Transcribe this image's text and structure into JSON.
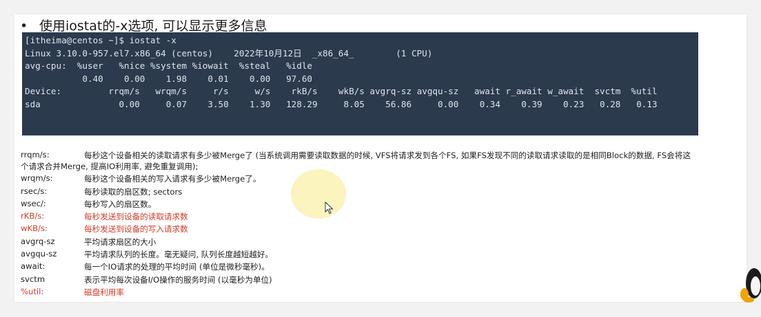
{
  "heading": {
    "bullet": "•",
    "text": "使用iostat的-x选项, 可以显示更多信息"
  },
  "terminal": {
    "lines": [
      "[itheima@centos ~]$ iostat -x",
      "Linux 3.10.0-957.el7.x86_64 (centos)    2022年10月12日  _x86_64_        (1 CPU)",
      "",
      "avg-cpu:  %user   %nice %system %iowait  %steal   %idle",
      "           0.40    0.00    1.98    0.01    0.00   97.60",
      "",
      "Device:         rrqm/s   wrqm/s     r/s     w/s    rkB/s    wkB/s avgrq-sz avgqu-sz   await r_await w_await  svctm  %util",
      "sda               0.00     0.07    3.50    1.30   128.29     8.05    56.86     0.00    0.34    0.39    0.23   0.28   0.13"
    ]
  },
  "definitions": [
    {
      "term": "rrqm/s:",
      "desc": "每秒这个设备相关的读取请求有多少被Merge了 (当系统调用需要读取数据的时候, VFS将请求发到各个FS, 如果FS发现不同的读取请求读取的是相同Block的数据, FS会将这",
      "desc2": "个请求合并Merge, 提高IO利用率, 避免重复调用);",
      "red": false
    },
    {
      "term": "wrqm/s:",
      "desc": "每秒这个设备相关的写入请求有多少被Merge了。",
      "red": false
    },
    {
      "term": "rsec/s:",
      "desc": "每秒读取的扇区数; sectors",
      "red": false
    },
    {
      "term": "wsec/:",
      "desc": "每秒写入的扇区数。",
      "red": false
    },
    {
      "term": "rKB/s:",
      "desc": "每秒发送到设备的读取请求数",
      "red": true
    },
    {
      "term": "wKB/s:",
      "desc": "每秒发送到设备的写入请求数",
      "red": true
    },
    {
      "term": "avgrq-sz",
      "desc": "平均请求扇区的大小",
      "red": false
    },
    {
      "term": "avgqu-sz",
      "desc": "平均请求队列的长度。毫无疑问, 队列长度越短越好。",
      "red": false
    },
    {
      "term": "await:",
      "desc": "每一个IO请求的处理的平均时间 (单位是微秒毫秒)。",
      "red": false
    },
    {
      "term": "svctm",
      "desc": "表示平均每次设备I/O操作的服务时间 (以毫秒为单位)",
      "red": false
    },
    {
      "term": "%util:",
      "desc": "磁盘利用率",
      "red": true
    }
  ],
  "colors": {
    "terminal_bg": "#2c3a4d",
    "terminal_fg": "#dde3ea",
    "highlight_red": "#d23b2a"
  },
  "icons": [
    "mouse-cursor-icon",
    "penguin-mascot-icon"
  ]
}
